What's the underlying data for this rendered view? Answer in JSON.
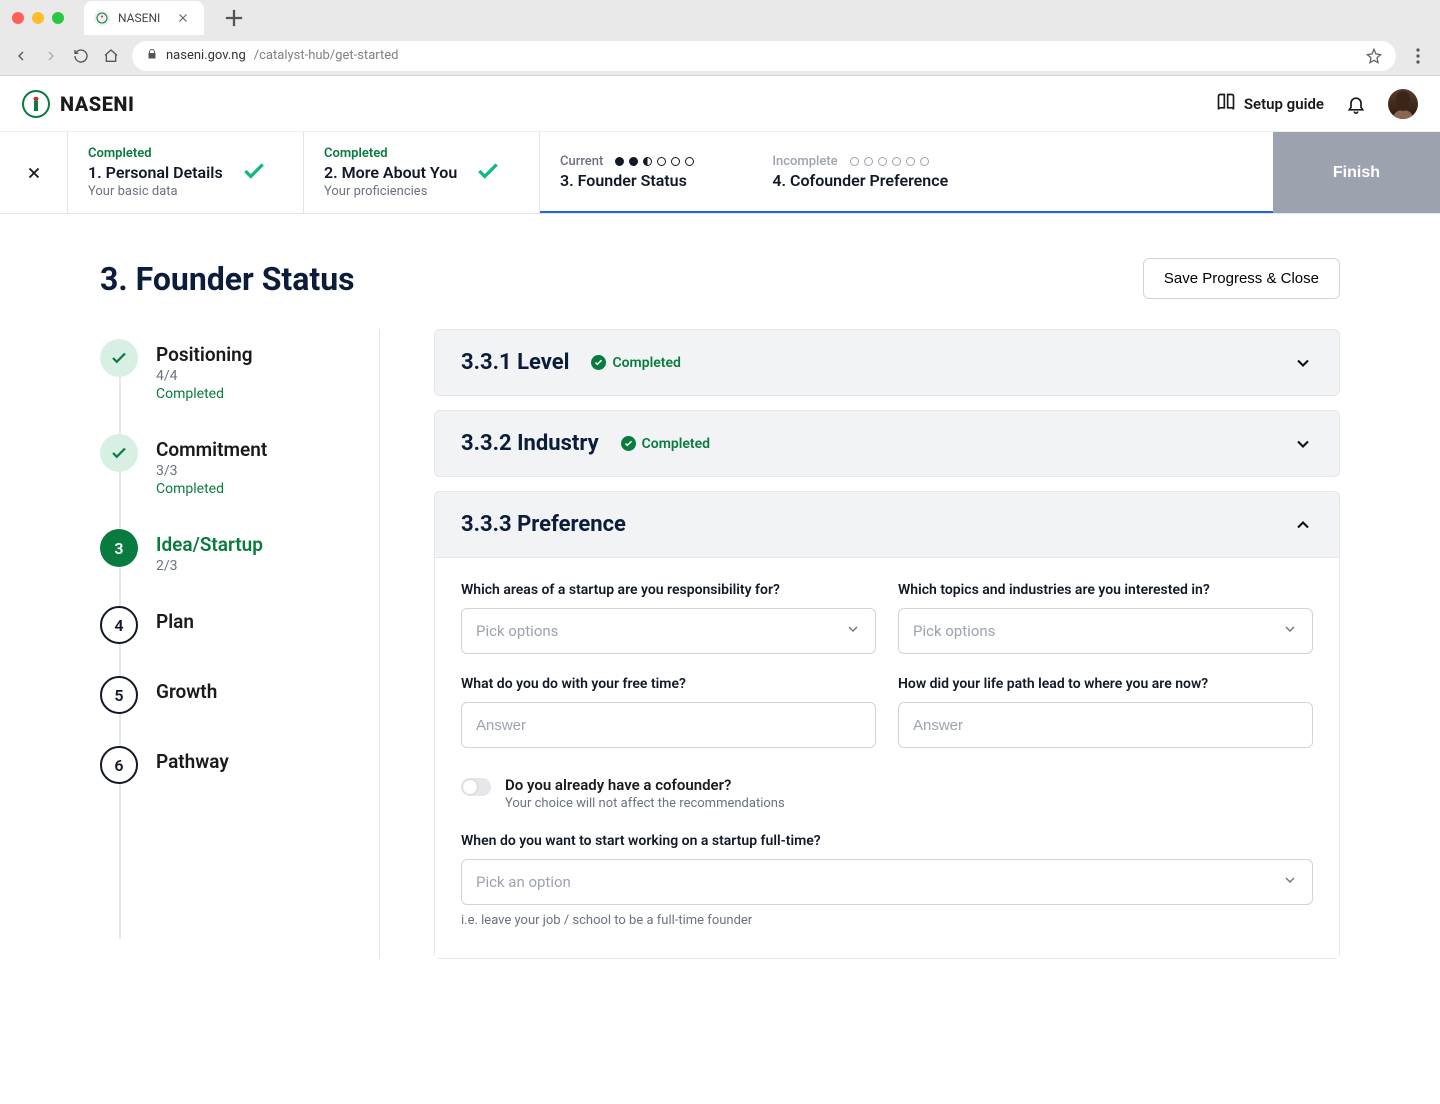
{
  "browser": {
    "tab_title": "NASENI",
    "url_host": "naseni.gov.ng",
    "url_path": "/catalyst-hub/get-started"
  },
  "header": {
    "brand": "NASENI",
    "setup_guide": "Setup guide"
  },
  "stepper": {
    "steps": [
      {
        "status": "Completed",
        "title": "1. Personal Details",
        "sub": "Your basic data"
      },
      {
        "status": "Completed",
        "title": "2. More About You",
        "sub": "Your proficiencies"
      },
      {
        "status": "Current",
        "title": "3. Founder Status"
      },
      {
        "status": "Incomplete",
        "title": "4. Cofounder Preference"
      }
    ],
    "finish": "Finish"
  },
  "page": {
    "title": "3. Founder Status",
    "save": "Save Progress & Close"
  },
  "leftnav": [
    {
      "label": "Positioning",
      "count": "4/4",
      "state": "Completed"
    },
    {
      "label": "Commitment",
      "count": "3/3",
      "state": "Completed"
    },
    {
      "label": "Idea/Startup",
      "count": "2/3"
    },
    {
      "num": "4",
      "label": "Plan"
    },
    {
      "num": "5",
      "label": "Growth"
    },
    {
      "num": "6",
      "label": "Pathway"
    }
  ],
  "accordions": {
    "level": {
      "title": "3.3.1 Level",
      "badge": "Completed"
    },
    "industry": {
      "title": "3.3.2 Industry",
      "badge": "Completed"
    },
    "preference": {
      "title": "3.3.3 Preference"
    }
  },
  "form": {
    "q1": "Which areas of a startup are you responsibility for?",
    "q2": "Which topics and industries are you interested in?",
    "q3": "What do you do with your free time?",
    "q4": "How did your life path lead to where you are now?",
    "pick_options": "Pick options",
    "answer": "Answer",
    "toggle_title": "Do you already have a cofounder?",
    "toggle_sub": "Your choice will not affect the recommendations",
    "q5": "When do you want to start working on a startup full-time?",
    "pick_option": "Pick an option",
    "helper": "i.e. leave your job / school to be a full-time founder"
  }
}
